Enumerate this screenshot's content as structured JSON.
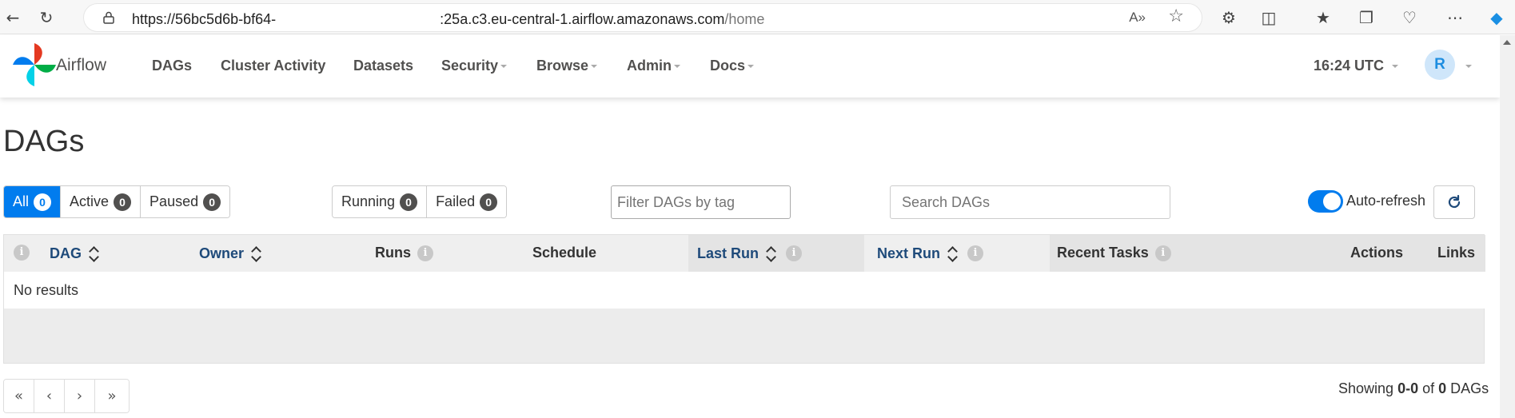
{
  "browser": {
    "url_host": "https://56bc5d6b-bf64-",
    "url_masked": "                                         ",
    "url_rest": ":25a.c3.eu-central-1.airflow.amazonaws.com",
    "url_path": "/home",
    "read_aloud_label": "A»"
  },
  "navbar": {
    "brand": "Airflow",
    "items": [
      {
        "label": "DAGs",
        "dropdown": false
      },
      {
        "label": "Cluster Activity",
        "dropdown": false
      },
      {
        "label": "Datasets",
        "dropdown": false
      },
      {
        "label": "Security",
        "dropdown": true
      },
      {
        "label": "Browse",
        "dropdown": true
      },
      {
        "label": "Admin",
        "dropdown": true
      },
      {
        "label": "Docs",
        "dropdown": true
      }
    ],
    "time": "16:24 UTC",
    "avatar_initial": "R"
  },
  "page": {
    "title": "DAGs"
  },
  "filters": {
    "status": [
      {
        "label": "All",
        "count": "0",
        "active": true
      },
      {
        "label": "Active",
        "count": "0",
        "active": false
      },
      {
        "label": "Paused",
        "count": "0",
        "active": false
      }
    ],
    "run_state": [
      {
        "label": "Running",
        "count": "0"
      },
      {
        "label": "Failed",
        "count": "0"
      }
    ],
    "tag_placeholder": "Filter DAGs by tag",
    "search_placeholder": "Search DAGs",
    "auto_refresh_label": "Auto-refresh",
    "auto_refresh_on": true
  },
  "table": {
    "columns": {
      "dag": "DAG",
      "owner": "Owner",
      "runs": "Runs",
      "schedule": "Schedule",
      "last_run": "Last Run",
      "next_run": "Next Run",
      "recent_tasks": "Recent Tasks",
      "actions": "Actions",
      "links": "Links"
    },
    "empty_text": "No results"
  },
  "pagination": {
    "first": "«",
    "prev": "‹",
    "next": "›",
    "last": "»",
    "showing_prefix": "Showing",
    "range": "0-0",
    "of": "of",
    "total": "0",
    "suffix": "DAGs"
  },
  "colors": {
    "accent": "#017cee",
    "sort_header": "#1e4a7a",
    "badge_bg": "#51504f"
  }
}
